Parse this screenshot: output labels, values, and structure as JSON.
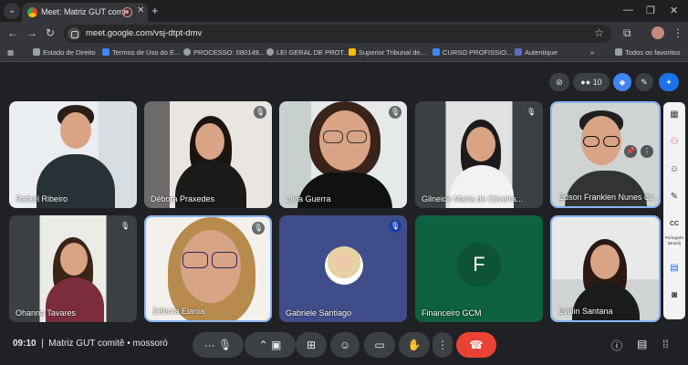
{
  "browser": {
    "tab_title": "Meet: Matriz GUT comitê -",
    "tab_list_icon": "⌄",
    "close_tab": "✕",
    "new_tab": "+",
    "url": "meet.google.com/vsj-dtpt-dmv",
    "bookmarks": [
      {
        "label": "Estado de Direito",
        "color": "#9aa0a6"
      },
      {
        "label": "Termos de Uso do E...",
        "color": "#4285f4"
      },
      {
        "label": "PROCESSO: 080149...",
        "color": "#9aa0a6"
      },
      {
        "label": "LEI GERAL DE PROT...",
        "color": "#9aa0a6"
      },
      {
        "label": "Superior Tribunal de...",
        "color": "#fbbc04"
      },
      {
        "label": "CURSO PROFISSIO...",
        "color": "#4285f4"
      },
      {
        "label": "Autentique",
        "color": "#5c6bc0"
      },
      {
        "label": "Todos os favoritos",
        "color": "#9aa0a6"
      }
    ]
  },
  "meeting": {
    "participant_count": "10",
    "time": "09:10",
    "title": "Matriz GUT comitê • mossoró",
    "side_label": "Português (Brasil)",
    "cc_label": "CC",
    "participants": [
      {
        "name": "Rafael Ribeiro",
        "muted": false
      },
      {
        "name": "Débora Praxedes",
        "muted": true
      },
      {
        "name": "Lívia Guerra",
        "muted": true
      },
      {
        "name": "Gilneide Maria de Oliveira...",
        "muted": true
      },
      {
        "name": "Edson Franklen Nunes de ...",
        "muted": false
      },
      {
        "name": "Ohanna Tavares",
        "muted": true
      },
      {
        "name": "Débora Elania",
        "muted": true
      },
      {
        "name": "Gabriele Santiago",
        "muted": true
      },
      {
        "name": "Financeiro GCM",
        "muted": false,
        "initial": "F"
      },
      {
        "name": "Evillin Santana",
        "muted": false
      }
    ]
  }
}
